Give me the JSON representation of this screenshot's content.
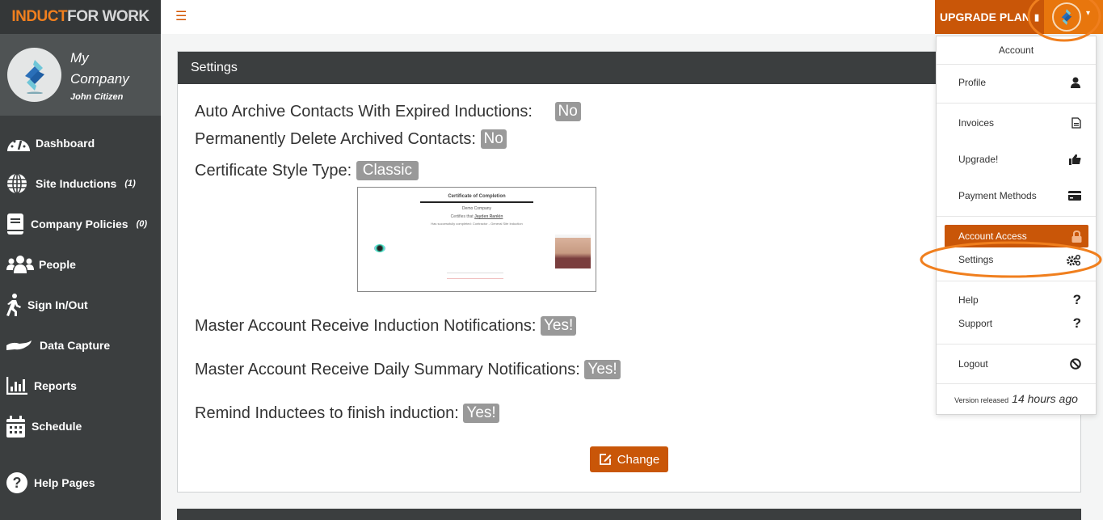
{
  "brand": {
    "logo_part1": "INDUCT",
    "logo_part2": "FOR WORK",
    "accent": "#c95608"
  },
  "profile": {
    "company_line1": "My",
    "company_line2": "Company",
    "user": "John Citizen"
  },
  "sidebar": {
    "items": [
      {
        "label": "Dashboard",
        "icon": "dashboard-gauge-icon",
        "count": ""
      },
      {
        "label": "Site Inductions",
        "icon": "globe-icon",
        "count": "(1)"
      },
      {
        "label": "Company Policies",
        "icon": "book-icon",
        "count": "(0)"
      },
      {
        "label": "People",
        "icon": "users-icon",
        "count": ""
      },
      {
        "label": "Sign In/Out",
        "icon": "walking-icon",
        "count": ""
      },
      {
        "label": "Data Capture",
        "icon": "hand-icon",
        "count": ""
      },
      {
        "label": "Reports",
        "icon": "bar-chart-icon",
        "count": ""
      },
      {
        "label": "Schedule",
        "icon": "calendar-icon",
        "count": ""
      },
      {
        "label": "Help Pages",
        "icon": "question-circle-icon",
        "count": ""
      }
    ]
  },
  "topbar": {
    "menu_icon": "hamburger-icon",
    "upgrade_label": "UPGRADE PLAN"
  },
  "settings": {
    "title": "Settings",
    "rows": [
      {
        "label": "Auto Archive Contacts With Expired Inductions:",
        "value": "No"
      },
      {
        "label": "Permanently Delete Archived Contacts:",
        "value": "No"
      },
      {
        "label": "Certificate Style Type:",
        "value": "Classic"
      },
      {
        "label": "Master Account Receive Induction Notifications:",
        "value": "Yes!"
      },
      {
        "label": "Master Account Receive Daily Summary Notifications:",
        "value": "Yes!"
      },
      {
        "label": "Remind Inductees to finish induction:",
        "value": "Yes!"
      }
    ],
    "certificate": {
      "title": "Certificate of Completion",
      "company": "Demo Company",
      "certifies": "Certifies that",
      "name": "Jayden Rankin",
      "completed": "Has successfully completed: Contractor - General Site Induction"
    },
    "change_label": "Change"
  },
  "account_menu": {
    "header": "Account",
    "items": [
      {
        "label": "Profile",
        "icon": "user-icon"
      },
      {
        "label": "Invoices",
        "icon": "file-icon"
      },
      {
        "label": "Upgrade!",
        "icon": "thumbs-up-icon"
      },
      {
        "label": "Payment Methods",
        "icon": "credit-card-icon"
      },
      {
        "label": "Account Access",
        "icon": "lock-icon"
      },
      {
        "label": "Settings",
        "icon": "cogs-icon"
      },
      {
        "label": "Help",
        "icon": "question-icon"
      },
      {
        "label": "Support",
        "icon": "question-icon"
      },
      {
        "label": "Logout",
        "icon": "ban-icon"
      }
    ],
    "footer_small": "Version released",
    "footer_time": "14 hours ago"
  }
}
